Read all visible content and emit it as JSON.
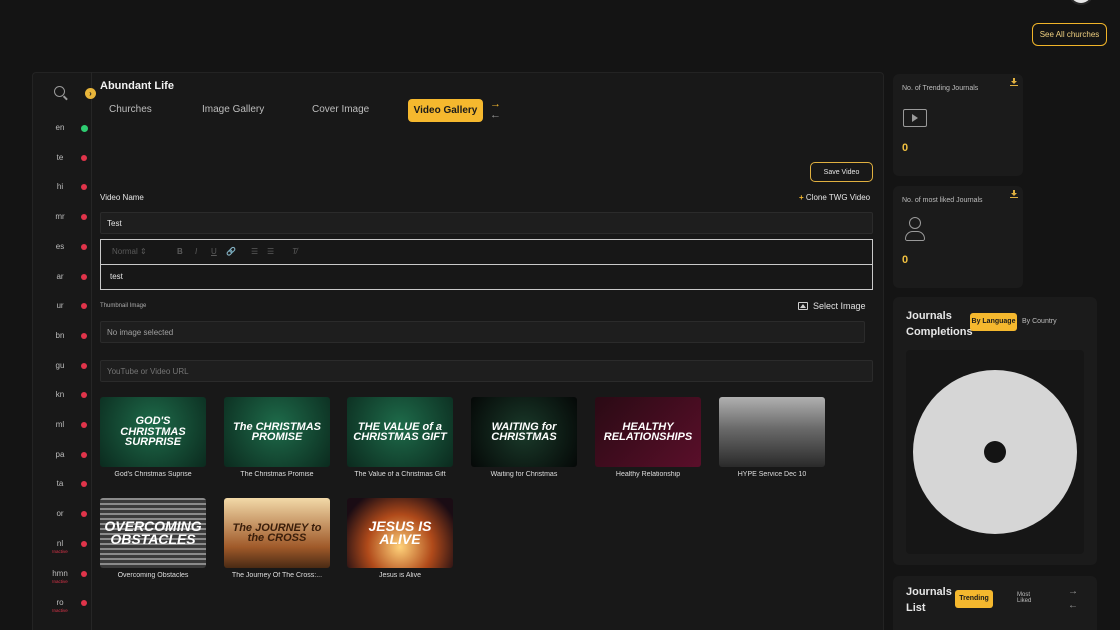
{
  "header": {
    "see_all_label": "See All churches"
  },
  "sidebar": {
    "languages": [
      {
        "code": "en",
        "status": "ok",
        "sub": ""
      },
      {
        "code": "te",
        "status": "missing",
        "sub": ""
      },
      {
        "code": "hi",
        "status": "missing",
        "sub": ""
      },
      {
        "code": "mr",
        "status": "missing",
        "sub": ""
      },
      {
        "code": "es",
        "status": "missing",
        "sub": ""
      },
      {
        "code": "ar",
        "status": "missing",
        "sub": ""
      },
      {
        "code": "ur",
        "status": "missing",
        "sub": ""
      },
      {
        "code": "bn",
        "status": "missing",
        "sub": ""
      },
      {
        "code": "gu",
        "status": "missing",
        "sub": ""
      },
      {
        "code": "kn",
        "status": "missing",
        "sub": ""
      },
      {
        "code": "ml",
        "status": "missing",
        "sub": ""
      },
      {
        "code": "pa",
        "status": "missing",
        "sub": ""
      },
      {
        "code": "ta",
        "status": "missing",
        "sub": ""
      },
      {
        "code": "or",
        "status": "missing",
        "sub": ""
      },
      {
        "code": "nl",
        "status": "missing",
        "sub": "Inactive"
      },
      {
        "code": "hmn",
        "status": "missing",
        "sub": "Inactive"
      },
      {
        "code": "ro",
        "status": "missing",
        "sub": "Inactive"
      }
    ]
  },
  "main": {
    "title": "Abundant Life",
    "tabs": [
      {
        "label": "Churches"
      },
      {
        "label": "Image Gallery"
      },
      {
        "label": "Cover Image"
      },
      {
        "label": "Video Gallery"
      }
    ],
    "save_label": "Save Video",
    "video_name_label": "Video Name",
    "clone_label": "Clone TWG Video",
    "video_name_value": "Test",
    "editor": {
      "format": "Normal",
      "body": "test"
    },
    "thumbnail_label": "Thumbnail Image",
    "select_image_label": "Select Image",
    "no_image_text": "No image selected",
    "url_placeholder": "YouTube or Video URL",
    "gallery": [
      {
        "caption": "God's Christmas Suprise",
        "art": "GOD'S CHRISTMAS SURPRISE",
        "style": "t-green"
      },
      {
        "caption": "The Christmas Promise",
        "art": "The CHRISTMAS PROMISE",
        "style": "t-green"
      },
      {
        "caption": "The Value of a Christmas Gift",
        "art": "THE VALUE of a CHRISTMAS GIFT",
        "style": "t-green"
      },
      {
        "caption": "Waiting for Christmas",
        "art": "WAITING for CHRISTMAS",
        "style": "t-dark"
      },
      {
        "caption": "Healthy Relationship",
        "art": "HEALTHY RELATIONSHIPS",
        "style": "t-pink"
      },
      {
        "caption": "HYPE Service Dec 10",
        "art": "",
        "style": "t-photo"
      },
      {
        "caption": "Overcoming Obstacles",
        "art": "OVERCOMING OBSTACLES",
        "style": "t-maze"
      },
      {
        "caption": "The Journey Of The Cross:...",
        "art": "The JOURNEY to the CROSS",
        "style": "t-gold"
      },
      {
        "caption": "Jesus is Alive",
        "art": "JESUS IS ALIVE",
        "style": "t-alive"
      }
    ]
  },
  "stats": {
    "trending_title": "No. of Trending Journals",
    "trending_value": "0",
    "liked_title": "No. of most liked Journals",
    "liked_value": "0"
  },
  "completions": {
    "title": "Journals Completions",
    "by_language": "By Language",
    "by_country": "By Country"
  },
  "journals_list": {
    "title": "Journals List",
    "trending": "Trending",
    "most_liked": "Most Liked"
  },
  "colors": {
    "accent": "#f5b82e",
    "error": "#e0344a",
    "ok": "#2ecc71"
  }
}
